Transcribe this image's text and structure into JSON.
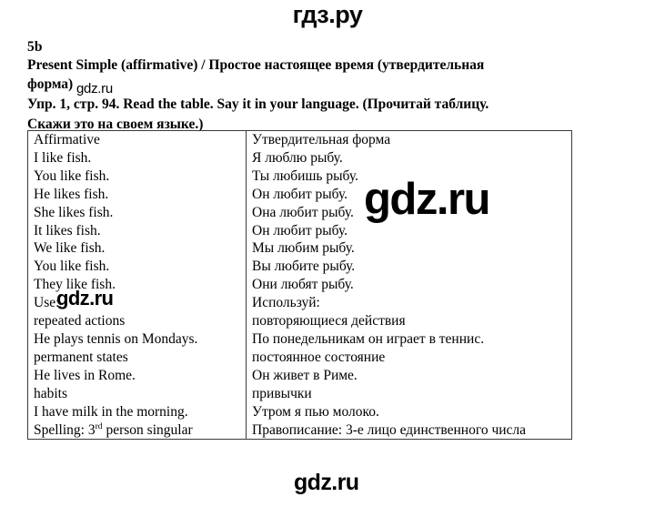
{
  "watermarks": {
    "top": "гдз.ру",
    "header_small": "gdz.ru",
    "table_large": "gdz.ru",
    "use_row": "gdz.ru",
    "bottom": "gdz.ru"
  },
  "heading": {
    "unit_label": "5b",
    "title": "Present Simple (affirmative) / Простое настоящее время (утвердительная форма)",
    "title_line1": "Present Simple (affirmative) / Простое настоящее время (утвердительная",
    "title_line2": "форма)",
    "task": "Упр. 1, стр. 94. Read the table. Say it in your language. (Прочитай таблицу. Скажи это на своем языке.)",
    "task_line1": "Упр. 1, стр. 94. Read the table. Say it in your language. (Прочитай таблицу.",
    "task_line2": "Скажи это на своем языке.)"
  },
  "table": {
    "columns": [
      "Affirmative",
      "Утвердительная форма"
    ],
    "rows": [
      {
        "en": "Affirmative",
        "ru": "Утвердительная форма"
      },
      {
        "en": "I like fish.",
        "ru": "Я люблю рыбу."
      },
      {
        "en": "You like fish.",
        "ru": "Ты любишь рыбу."
      },
      {
        "en": "He likes fish.",
        "ru": "Он любит рыбу."
      },
      {
        "en": "She likes fish.",
        "ru": "Она любит рыбу."
      },
      {
        "en": "It likes fish.",
        "ru": "Он любит рыбу."
      },
      {
        "en": "We like fish.",
        "ru": "Мы любим рыбу."
      },
      {
        "en": "You like fish.",
        "ru": "Вы любите рыбу."
      },
      {
        "en": "They like fish.",
        "ru": "Они любят рыбу."
      },
      {
        "en": "Use:",
        "ru": "Используй:"
      },
      {
        "en": "repeated actions",
        "ru": "повторяющиеся действия"
      },
      {
        "en": "He plays tennis on Mondays.",
        "ru": "По понедельникам он играет в теннис."
      },
      {
        "en": "permanent states",
        "ru": "постоянное состояние"
      },
      {
        "en": "He lives in Rome.",
        "ru": "Он живет в Риме."
      },
      {
        "en": "habits",
        "ru": "привычки"
      },
      {
        "en": "I have milk in the morning.",
        "ru": "Утром я пью молоко."
      },
      {
        "en": "Spelling: 3rd person singular",
        "en_html": "Spelling: 3<sup>rd</sup> person singular",
        "ru": "Правописание: 3-е лицо единственного числа"
      }
    ]
  }
}
